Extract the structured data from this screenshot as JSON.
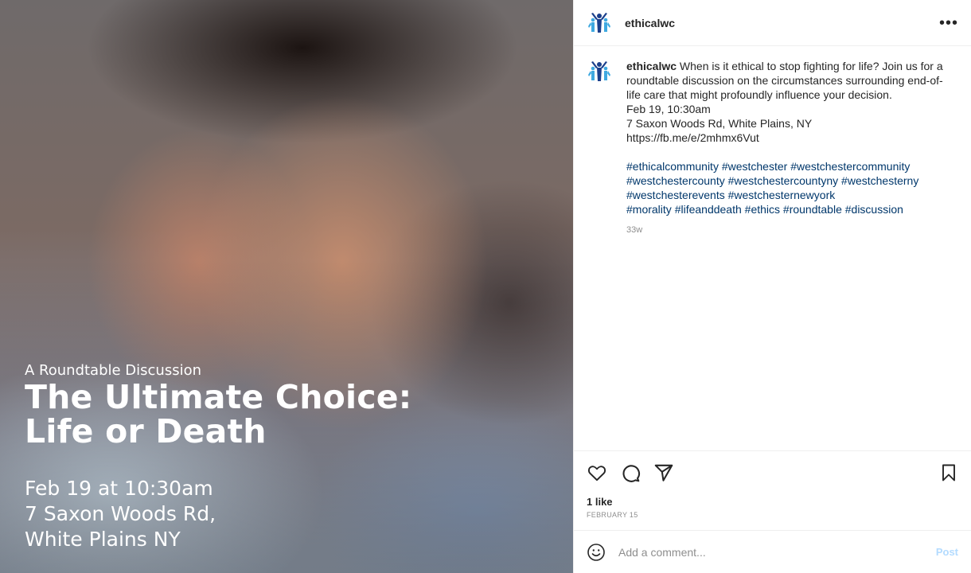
{
  "post": {
    "username": "ethicalwc",
    "image_overlay": {
      "subtitle": "A Roundtable Discussion",
      "title_line1": "The Ultimate Choice:",
      "title_line2": "Life or Death",
      "details_line1": "Feb 19 at 10:30am",
      "details_line2": "7 Saxon Woods Rd,",
      "details_line3": "White Plains NY"
    },
    "caption": {
      "username": "ethicalwc",
      "text": "When is it ethical to stop fighting for life? Join us for a roundtable discussion on the circumstances surrounding end-of-life care that might profoundly influence your decision.",
      "date_line": "Feb 19, 10:30am",
      "address_line": "7 Saxon Woods Rd, White Plains, NY",
      "link": "https://fb.me/e/2mhmx6Vut",
      "hashtag_lines": [
        [
          "#ethicalcommunity",
          "#westchester",
          "#westchestercommunity"
        ],
        [
          "#westchestercounty",
          "#westchestercountyny",
          "#westchesterny"
        ],
        [
          "#westchesterevents",
          "#westchesternewyork"
        ],
        [
          "#morality",
          "#lifeanddeath",
          "#ethics",
          "#roundtable",
          "#discussion"
        ]
      ],
      "age": "33w"
    },
    "likes": "1 like",
    "date": "FEBRUARY 15",
    "comment_placeholder": "Add a comment...",
    "post_button": "Post",
    "colors": {
      "hashtag": "#00376b",
      "post_button": "#b3dbff",
      "logo_dark": "#1b3f8b",
      "logo_light": "#3fa9e0"
    }
  }
}
